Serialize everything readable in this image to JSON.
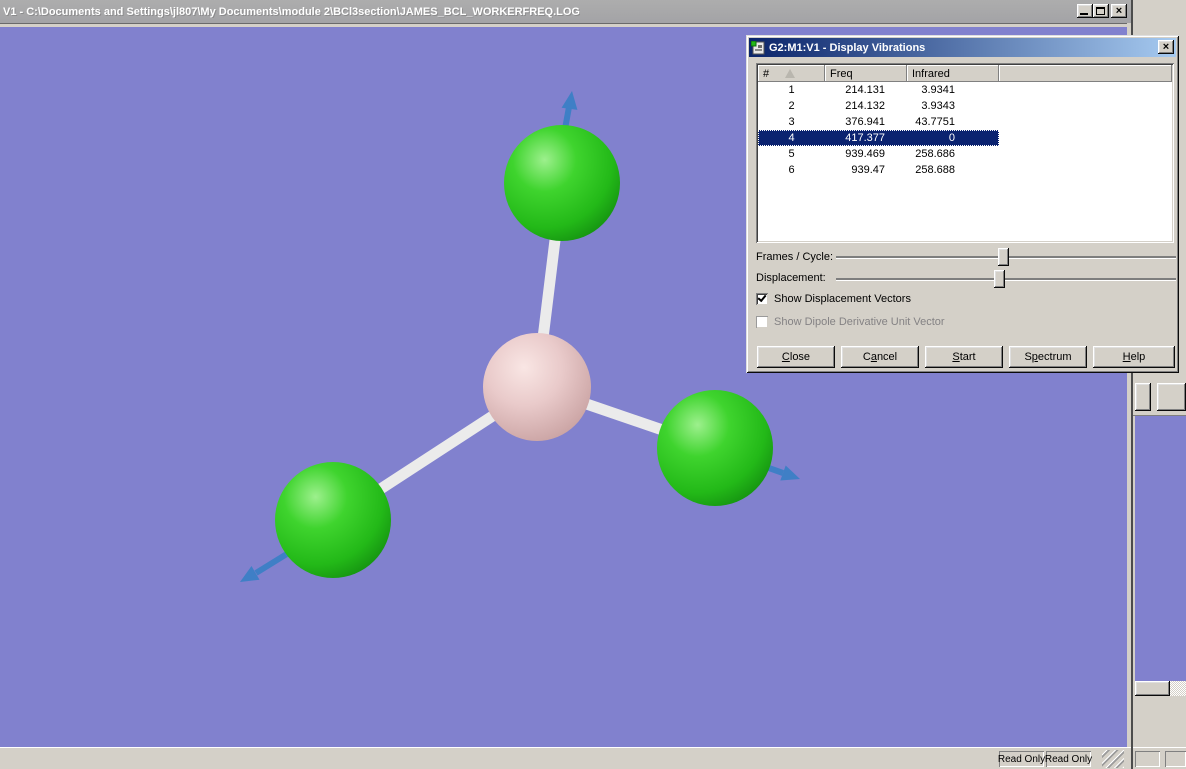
{
  "window": {
    "title": "V1 - C:\\Documents and Settings\\jl807\\My Documents\\module 2\\BCl3section\\JAMES_BCL_WORKERFREQ.LOG",
    "close_glyph": "×"
  },
  "statusbar": {
    "panels": [
      "Read Only",
      "Read Only"
    ]
  },
  "dialog": {
    "title": "G2:M1:V1 - Display Vibrations",
    "close_glyph": "×",
    "table": {
      "columns": {
        "num": "#",
        "freq": "Freq",
        "infrared": "Infrared"
      },
      "rows": [
        {
          "num": "1",
          "freq": "214.131",
          "infrared": "3.9341"
        },
        {
          "num": "2",
          "freq": "214.132",
          "infrared": "3.9343"
        },
        {
          "num": "3",
          "freq": "376.941",
          "infrared": "43.7751"
        },
        {
          "num": "4",
          "freq": "417.377",
          "infrared": "0"
        },
        {
          "num": "5",
          "freq": "939.469",
          "infrared": "258.686"
        },
        {
          "num": "6",
          "freq": "939.47",
          "infrared": "258.688"
        }
      ],
      "selected_row_number": "4"
    },
    "frames_slider_label": "Frames / Cycle:",
    "displacement_slider_label": "Displacement:",
    "sliders": {
      "frames_pct": 49,
      "displacement_pct": 48
    },
    "checkbox_vectors": {
      "label": "Show Displacement Vectors",
      "checked": true
    },
    "checkbox_dipole": {
      "label": "Show Dipole Derivative Unit Vector",
      "checked": false,
      "disabled": true
    },
    "buttons": {
      "close": {
        "pre": "",
        "key": "C",
        "post": "lose"
      },
      "cancel": {
        "pre": "C",
        "key": "a",
        "post": "ncel"
      },
      "start": {
        "pre": "",
        "key": "S",
        "post": "tart"
      },
      "spectrum": {
        "pre": "S",
        "key": "p",
        "post": "ectrum"
      },
      "help": {
        "pre": "",
        "key": "H",
        "post": "elp"
      }
    }
  },
  "molecule": {
    "formula": "BCl3",
    "center_atom": "B",
    "outer_atoms": [
      "Cl",
      "Cl",
      "Cl"
    ],
    "displacement_vectors_shown": true
  },
  "colors": {
    "desktop": "#8181ce",
    "chlorine": "#2ec421",
    "boron": "#e4c0c0",
    "bond": "#ebebeb",
    "vector": "#3f7fc6",
    "selection": "#0b2370",
    "titlebar_inactive": "#a8a8a8",
    "dialog_title_start": "#0a246a",
    "dialog_title_end": "#a6caf0",
    "chrome": "#d4d0c8"
  }
}
